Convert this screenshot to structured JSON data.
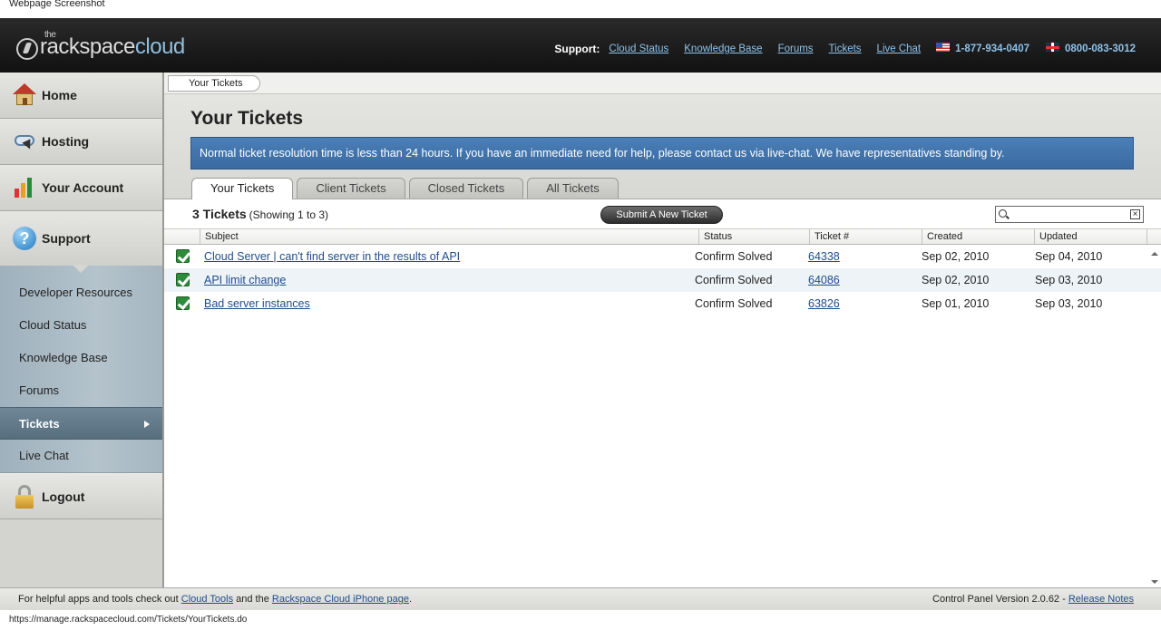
{
  "caption": "Webpage Screenshot",
  "header": {
    "logo": {
      "the": "the",
      "brand1": "rackspace",
      "brand2": "cloud"
    },
    "support_label": "Support:",
    "links": [
      "Cloud Status",
      "Knowledge Base",
      "Forums",
      "Tickets",
      "Live Chat"
    ],
    "phone_us": "1-877-934-0407",
    "phone_uk": "0800-083-3012"
  },
  "sidebar": {
    "main": [
      {
        "label": "Home",
        "icon": "home-icon"
      },
      {
        "label": "Hosting",
        "icon": "cloud-icon"
      },
      {
        "label": "Your Account",
        "icon": "bar-chart-icon"
      },
      {
        "label": "Support",
        "icon": "question-icon"
      }
    ],
    "sub": [
      "Developer Resources",
      "Cloud Status",
      "Knowledge Base",
      "Forums",
      "Tickets",
      "Live Chat"
    ],
    "active_sub": "Tickets",
    "logout": "Logout"
  },
  "breadcrumb": "Your Tickets",
  "page_title": "Your Tickets",
  "notice": "Normal ticket resolution time is less than 24 hours. If you have an immediate need for help, please contact us via live-chat. We have representatives standing by.",
  "tabs": [
    "Your Tickets",
    "Client Tickets",
    "Closed Tickets",
    "All Tickets"
  ],
  "active_tab": "Your Tickets",
  "toolbar": {
    "count": "3 Tickets",
    "showing": "(Showing 1 to 3)",
    "submit": "Submit A New Ticket",
    "search_value": ""
  },
  "table": {
    "columns": [
      "Subject",
      "Status",
      "Ticket #",
      "Created",
      "Updated"
    ],
    "rows": [
      {
        "subject": "Cloud Server | can't find server in the results of API",
        "status": "Confirm Solved",
        "ticket": "64338",
        "created": "Sep 02, 2010",
        "updated": "Sep 04, 2010"
      },
      {
        "subject": "API limit change",
        "status": "Confirm Solved",
        "ticket": "64086",
        "created": "Sep 02, 2010",
        "updated": "Sep 03, 2010"
      },
      {
        "subject": "Bad server instances",
        "status": "Confirm Solved",
        "ticket": "63826",
        "created": "Sep 01, 2010",
        "updated": "Sep 03, 2010"
      }
    ]
  },
  "footer": {
    "text1": "For helpful apps and tools check out",
    "link1": "Cloud Tools",
    "text2": "and the",
    "link2": "Rackspace Cloud iPhone page",
    "text3": ".",
    "version": "Control Panel Version 2.0.62 -",
    "release": "Release Notes"
  },
  "status_url": "https://manage.rackspacecloud.com/Tickets/YourTickets.do"
}
